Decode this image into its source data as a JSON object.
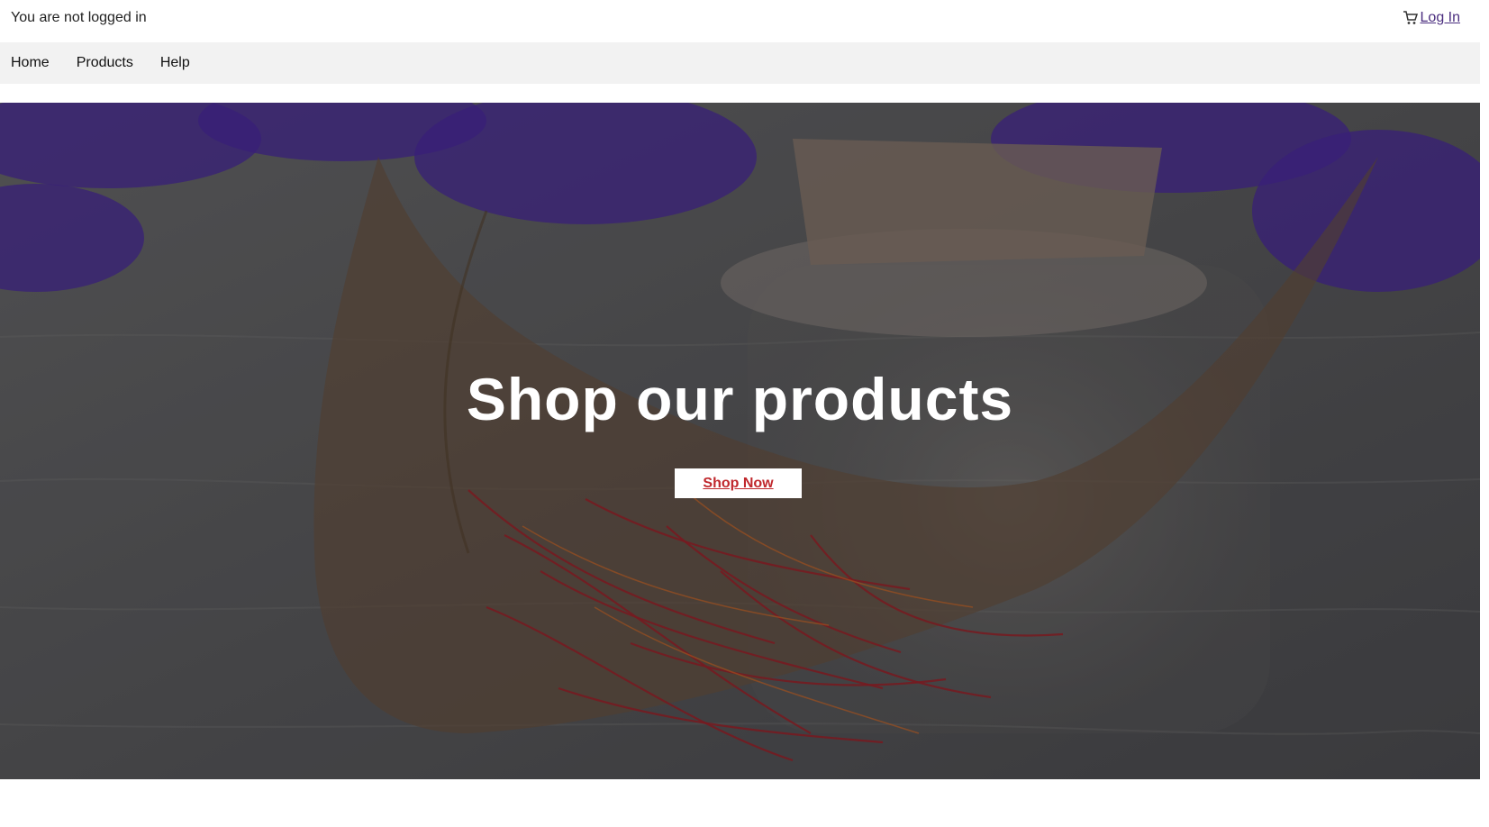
{
  "header": {
    "login_status": "You are not logged in",
    "login_label": "Log In",
    "cart_icon": "cart-icon"
  },
  "nav": {
    "items": [
      {
        "label": "Home"
      },
      {
        "label": "Products"
      },
      {
        "label": "Help"
      }
    ]
  },
  "hero": {
    "title": "Shop our products",
    "button_label": "Shop Now",
    "button_text_color": "#c0282d",
    "overlay_color": "#5a5a5e",
    "accent_colors": {
      "flowers": "#4b2aa0",
      "saffron": "#a0222a",
      "leaf": "#6b5340"
    }
  }
}
